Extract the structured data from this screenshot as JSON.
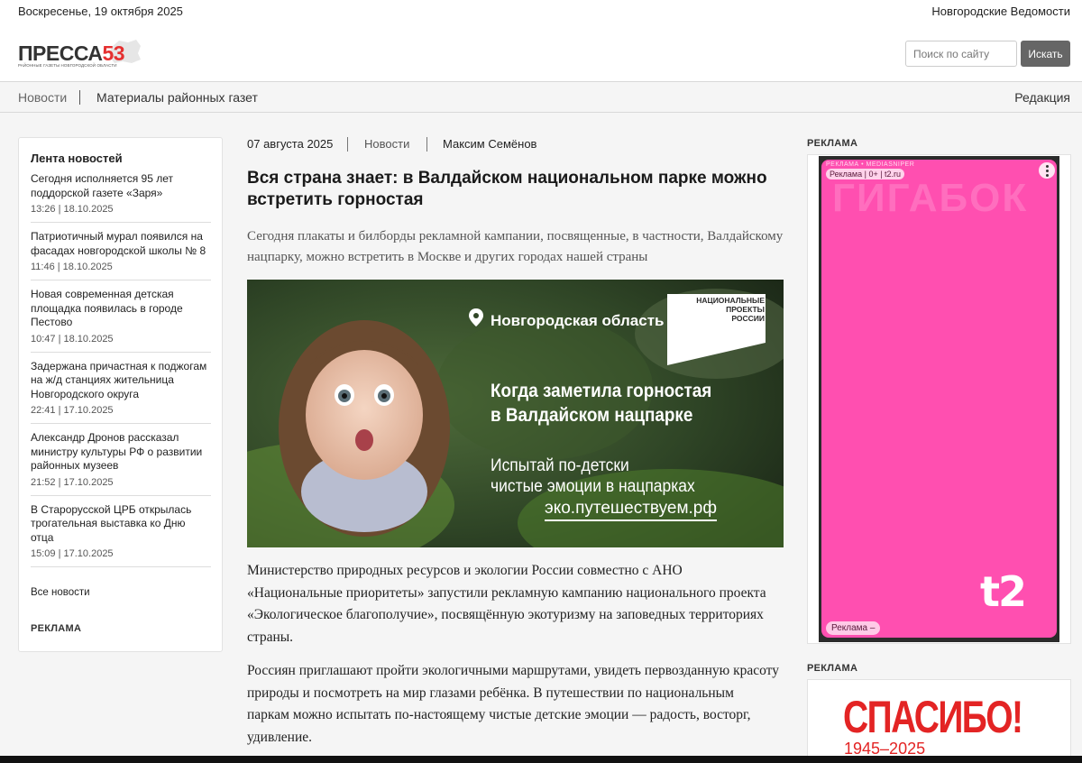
{
  "topbar": {
    "date": "Воскресенье, 19 октября 2025",
    "site_name": "Новгородские Ведомости"
  },
  "header": {
    "logo_main": "ПРЕССА",
    "logo_num": "53",
    "logo_sub": "РАЙОННЫЕ ГАЗЕТЫ НОВГОРОДСКОЙ ОБЛАСТИ",
    "search_placeholder": "Поиск по сайту",
    "search_button": "Искать"
  },
  "nav": {
    "news": "Новости",
    "papers": "Материалы районных газет",
    "redaction": "Редакция"
  },
  "feed": {
    "title": "Лента новостей",
    "items": [
      {
        "title": "Сегодня исполняется 95 лет поддорской газете «Заря»",
        "meta": "13:26 | 18.10.2025"
      },
      {
        "title": "Патриотичный мурал появился на фасадах новгородской школы № 8",
        "meta": "11:46 | 18.10.2025"
      },
      {
        "title": "Новая современная детская площадка появилась в городе Пестово",
        "meta": "10:47 | 18.10.2025"
      },
      {
        "title": "Задержана причастная к поджогам на ж/д станциях жительница Новгородского округа",
        "meta": "22:41 | 17.10.2025"
      },
      {
        "title": "Александр Дронов рассказал министру культуры РФ о развитии районных музеев",
        "meta": "21:52 | 17.10.2025"
      },
      {
        "title": "В Старорусской ЦРБ открылась трогательная выставка ко Дню отца",
        "meta": "15:09 | 17.10.2025"
      }
    ],
    "all_news": "Все новости",
    "ad_label": "РЕКЛАМА"
  },
  "article": {
    "date": "07 августа 2025",
    "category": "Новости",
    "author": "Максим Семёнов",
    "title": "Вся страна знает: в Валдайском национальном парке можно встретить горностая",
    "lead": "Сегодня плакаты и билборды рекламной кампании, посвященные, в частности, Валдайскому нацпарку, можно встретить в Москве и других городах нашей страны",
    "image": {
      "location": "Новгородская область",
      "badge": [
        "НАЦИОНАЛЬНЫЕ",
        "ПРОЕКТЫ",
        "РОССИИ"
      ],
      "headline": [
        "Когда заметила горностая",
        "в Валдайском нацпарке"
      ],
      "subline": [
        "Испытай по-детски",
        "чистые эмоции в нацпарках"
      ],
      "url": "эко.путешествуем.рф"
    },
    "p1": " Министерство природных ресурсов и экологии России совместно с АНО «Национальные приоритеты»  запустили рекламную кампанию национального проекта «Экологическое благополучие», посвящённую экотуризму на заповедных территориях страны.",
    "p2": "Россиян приглашают пройти экологичными маршрутами, увидеть первозданную красоту природы и посмотреть на мир глазами ребёнка. В путешествии по национальным паркам можно испытать по-настоящему чистые детские эмоции — радость, восторг, удивление."
  },
  "right": {
    "ad1_label": "РЕКЛАМА",
    "ad1": {
      "tag": "РЕКЛАМА • MEDIASNIPER",
      "tag2": "Реклама | 0+ | t2.ru",
      "ghost": "ГИГАБОК",
      "logo": "t2",
      "foot": "Реклама   –"
    },
    "ad2_label": "РЕКЛАМА",
    "ad2": {
      "big": "СПАСИБО!",
      "years": "1945–2025"
    }
  },
  "colors": {
    "accent_red": "#e53030",
    "ad_pink": "#ff4fb0",
    "button_gray": "#666666"
  }
}
